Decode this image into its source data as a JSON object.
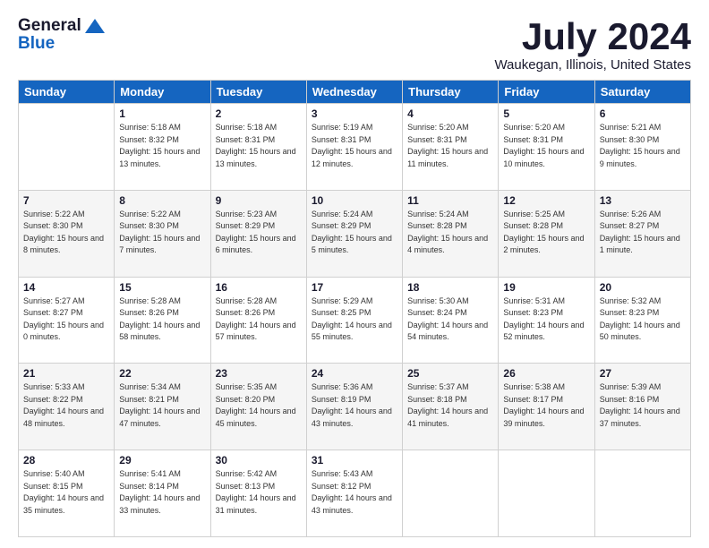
{
  "logo": {
    "general": "General",
    "blue": "Blue"
  },
  "header": {
    "month": "July 2024",
    "location": "Waukegan, Illinois, United States"
  },
  "weekdays": [
    "Sunday",
    "Monday",
    "Tuesday",
    "Wednesday",
    "Thursday",
    "Friday",
    "Saturday"
  ],
  "weeks": [
    [
      {
        "day": "",
        "sunrise": "",
        "sunset": "",
        "daylight": ""
      },
      {
        "day": "1",
        "sunrise": "Sunrise: 5:18 AM",
        "sunset": "Sunset: 8:32 PM",
        "daylight": "Daylight: 15 hours and 13 minutes."
      },
      {
        "day": "2",
        "sunrise": "Sunrise: 5:18 AM",
        "sunset": "Sunset: 8:31 PM",
        "daylight": "Daylight: 15 hours and 13 minutes."
      },
      {
        "day": "3",
        "sunrise": "Sunrise: 5:19 AM",
        "sunset": "Sunset: 8:31 PM",
        "daylight": "Daylight: 15 hours and 12 minutes."
      },
      {
        "day": "4",
        "sunrise": "Sunrise: 5:20 AM",
        "sunset": "Sunset: 8:31 PM",
        "daylight": "Daylight: 15 hours and 11 minutes."
      },
      {
        "day": "5",
        "sunrise": "Sunrise: 5:20 AM",
        "sunset": "Sunset: 8:31 PM",
        "daylight": "Daylight: 15 hours and 10 minutes."
      },
      {
        "day": "6",
        "sunrise": "Sunrise: 5:21 AM",
        "sunset": "Sunset: 8:30 PM",
        "daylight": "Daylight: 15 hours and 9 minutes."
      }
    ],
    [
      {
        "day": "7",
        "sunrise": "Sunrise: 5:22 AM",
        "sunset": "Sunset: 8:30 PM",
        "daylight": "Daylight: 15 hours and 8 minutes."
      },
      {
        "day": "8",
        "sunrise": "Sunrise: 5:22 AM",
        "sunset": "Sunset: 8:30 PM",
        "daylight": "Daylight: 15 hours and 7 minutes."
      },
      {
        "day": "9",
        "sunrise": "Sunrise: 5:23 AM",
        "sunset": "Sunset: 8:29 PM",
        "daylight": "Daylight: 15 hours and 6 minutes."
      },
      {
        "day": "10",
        "sunrise": "Sunrise: 5:24 AM",
        "sunset": "Sunset: 8:29 PM",
        "daylight": "Daylight: 15 hours and 5 minutes."
      },
      {
        "day": "11",
        "sunrise": "Sunrise: 5:24 AM",
        "sunset": "Sunset: 8:28 PM",
        "daylight": "Daylight: 15 hours and 4 minutes."
      },
      {
        "day": "12",
        "sunrise": "Sunrise: 5:25 AM",
        "sunset": "Sunset: 8:28 PM",
        "daylight": "Daylight: 15 hours and 2 minutes."
      },
      {
        "day": "13",
        "sunrise": "Sunrise: 5:26 AM",
        "sunset": "Sunset: 8:27 PM",
        "daylight": "Daylight: 15 hours and 1 minute."
      }
    ],
    [
      {
        "day": "14",
        "sunrise": "Sunrise: 5:27 AM",
        "sunset": "Sunset: 8:27 PM",
        "daylight": "Daylight: 15 hours and 0 minutes."
      },
      {
        "day": "15",
        "sunrise": "Sunrise: 5:28 AM",
        "sunset": "Sunset: 8:26 PM",
        "daylight": "Daylight: 14 hours and 58 minutes."
      },
      {
        "day": "16",
        "sunrise": "Sunrise: 5:28 AM",
        "sunset": "Sunset: 8:26 PM",
        "daylight": "Daylight: 14 hours and 57 minutes."
      },
      {
        "day": "17",
        "sunrise": "Sunrise: 5:29 AM",
        "sunset": "Sunset: 8:25 PM",
        "daylight": "Daylight: 14 hours and 55 minutes."
      },
      {
        "day": "18",
        "sunrise": "Sunrise: 5:30 AM",
        "sunset": "Sunset: 8:24 PM",
        "daylight": "Daylight: 14 hours and 54 minutes."
      },
      {
        "day": "19",
        "sunrise": "Sunrise: 5:31 AM",
        "sunset": "Sunset: 8:23 PM",
        "daylight": "Daylight: 14 hours and 52 minutes."
      },
      {
        "day": "20",
        "sunrise": "Sunrise: 5:32 AM",
        "sunset": "Sunset: 8:23 PM",
        "daylight": "Daylight: 14 hours and 50 minutes."
      }
    ],
    [
      {
        "day": "21",
        "sunrise": "Sunrise: 5:33 AM",
        "sunset": "Sunset: 8:22 PM",
        "daylight": "Daylight: 14 hours and 48 minutes."
      },
      {
        "day": "22",
        "sunrise": "Sunrise: 5:34 AM",
        "sunset": "Sunset: 8:21 PM",
        "daylight": "Daylight: 14 hours and 47 minutes."
      },
      {
        "day": "23",
        "sunrise": "Sunrise: 5:35 AM",
        "sunset": "Sunset: 8:20 PM",
        "daylight": "Daylight: 14 hours and 45 minutes."
      },
      {
        "day": "24",
        "sunrise": "Sunrise: 5:36 AM",
        "sunset": "Sunset: 8:19 PM",
        "daylight": "Daylight: 14 hours and 43 minutes."
      },
      {
        "day": "25",
        "sunrise": "Sunrise: 5:37 AM",
        "sunset": "Sunset: 8:18 PM",
        "daylight": "Daylight: 14 hours and 41 minutes."
      },
      {
        "day": "26",
        "sunrise": "Sunrise: 5:38 AM",
        "sunset": "Sunset: 8:17 PM",
        "daylight": "Daylight: 14 hours and 39 minutes."
      },
      {
        "day": "27",
        "sunrise": "Sunrise: 5:39 AM",
        "sunset": "Sunset: 8:16 PM",
        "daylight": "Daylight: 14 hours and 37 minutes."
      }
    ],
    [
      {
        "day": "28",
        "sunrise": "Sunrise: 5:40 AM",
        "sunset": "Sunset: 8:15 PM",
        "daylight": "Daylight: 14 hours and 35 minutes."
      },
      {
        "day": "29",
        "sunrise": "Sunrise: 5:41 AM",
        "sunset": "Sunset: 8:14 PM",
        "daylight": "Daylight: 14 hours and 33 minutes."
      },
      {
        "day": "30",
        "sunrise": "Sunrise: 5:42 AM",
        "sunset": "Sunset: 8:13 PM",
        "daylight": "Daylight: 14 hours and 31 minutes."
      },
      {
        "day": "31",
        "sunrise": "Sunrise: 5:43 AM",
        "sunset": "Sunset: 8:12 PM",
        "daylight": "Daylight: 14 hours and 43 minutes."
      },
      {
        "day": "",
        "sunrise": "",
        "sunset": "",
        "daylight": ""
      },
      {
        "day": "",
        "sunrise": "",
        "sunset": "",
        "daylight": ""
      },
      {
        "day": "",
        "sunrise": "",
        "sunset": "",
        "daylight": ""
      }
    ]
  ]
}
